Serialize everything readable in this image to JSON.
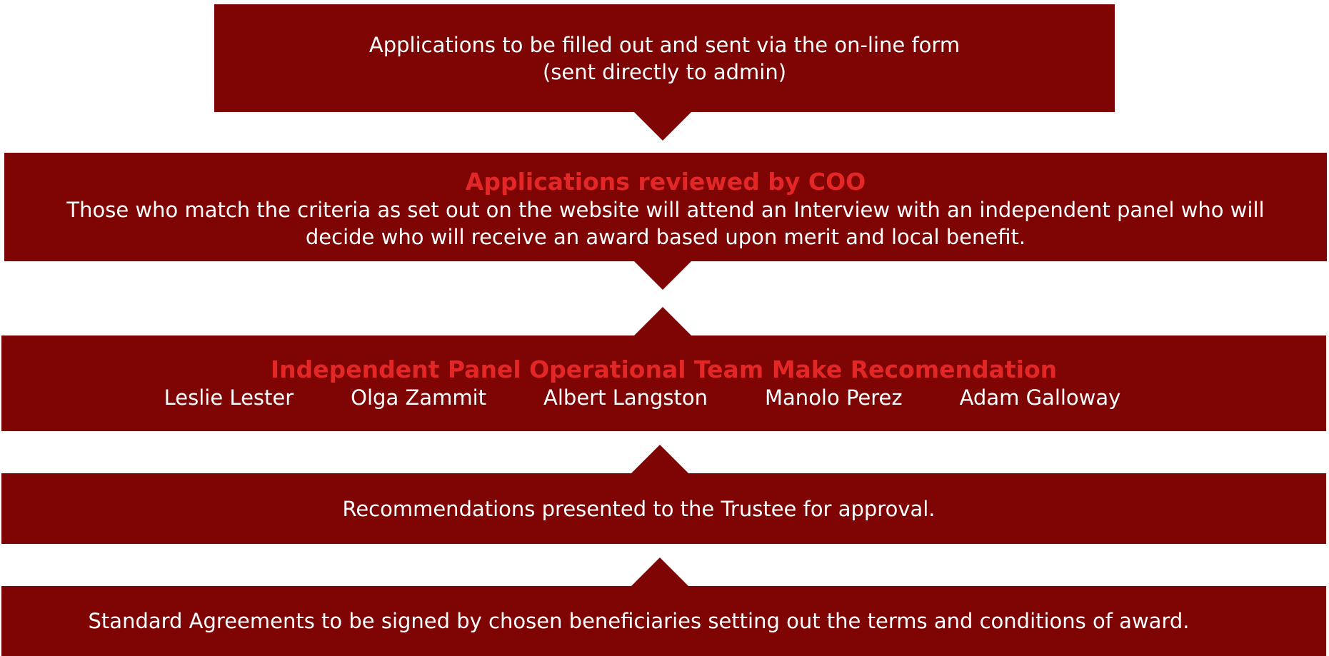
{
  "step1": {
    "lines": [
      "Applications to be filled out and sent via the on-line form",
      "(sent directly to admin)"
    ]
  },
  "step2": {
    "title": "Applications reviewed by COO",
    "lines": [
      "Those who match the criteria as set out on the website will attend an Interview with an independent panel who will",
      "decide who will receive an award based upon merit and local benefit."
    ]
  },
  "step3": {
    "title": "Independent Panel Operational Team Make Recomendation",
    "members": [
      "Leslie Lester",
      "Olga Zammit",
      "Albert Langston",
      "Manolo Perez",
      "Adam Galloway"
    ]
  },
  "step4": {
    "lines": [
      "Recommendations presented to the Trustee for approval."
    ]
  },
  "step5": {
    "lines": [
      "Standard Agreements to be signed by chosen beneficiaries setting out the terms and conditions of award."
    ]
  },
  "colors": {
    "box": "#7f0404",
    "title": "#e32626",
    "text": "#ffffff"
  }
}
